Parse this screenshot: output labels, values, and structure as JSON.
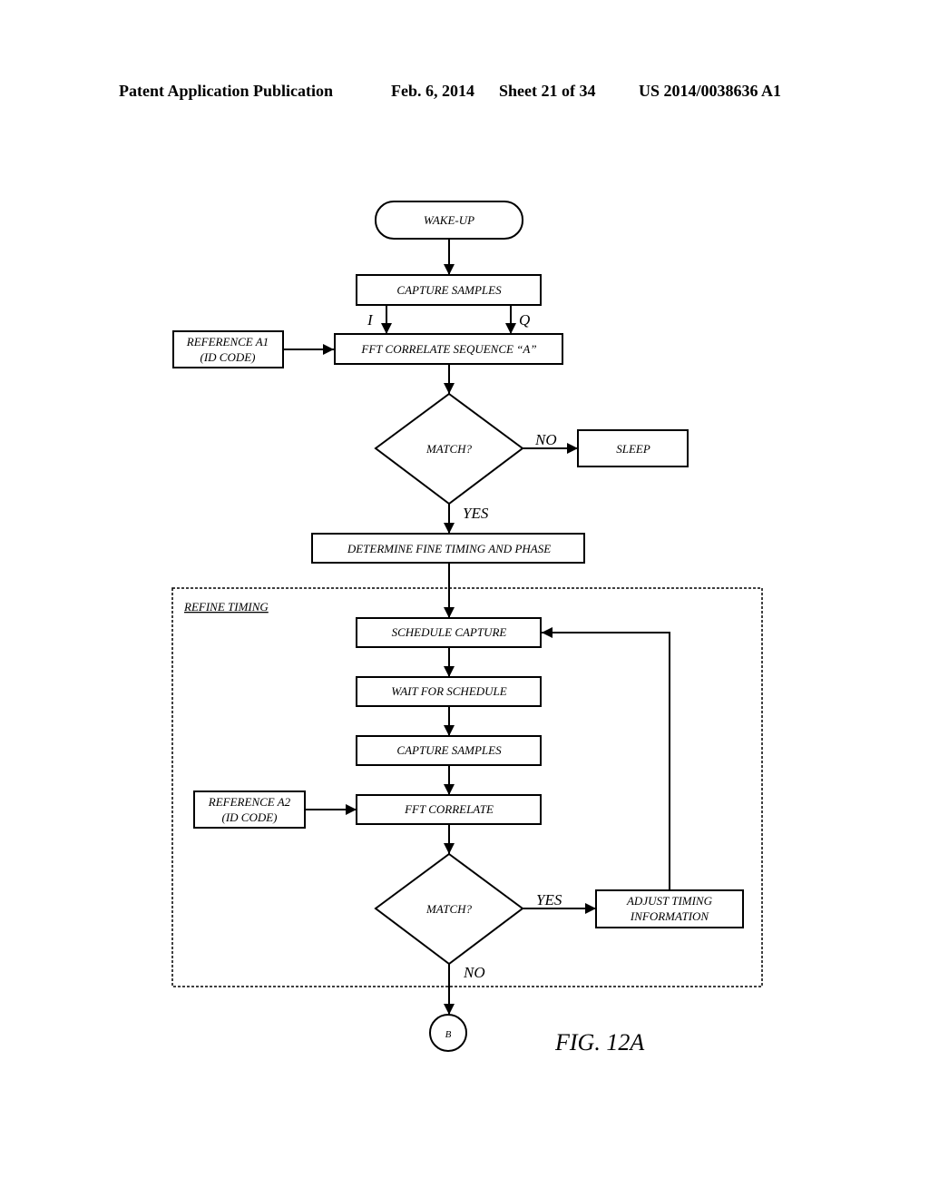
{
  "header": {
    "publication": "Patent Application Publication",
    "date": "Feb. 6, 2014",
    "sheet": "Sheet 21 of 34",
    "number": "US 2014/0038636 A1"
  },
  "diagram": {
    "nodes": {
      "wake_up": "WAKE-UP",
      "capture_samples_1": "CAPTURE SAMPLES",
      "reference_a1_line1": "REFERENCE A1",
      "reference_a1_line2": "(ID CODE)",
      "fft_correlate_seq_a": "FFT CORRELATE SEQUENCE “A”",
      "match_1": "MATCH?",
      "sleep": "SLEEP",
      "determine_fine_timing": "DETERMINE FINE TIMING AND PHASE",
      "schedule_capture": "SCHEDULE CAPTURE",
      "wait_for_schedule": "WAIT FOR SCHEDULE",
      "capture_samples_2": "CAPTURE SAMPLES",
      "reference_a2_line1": "REFERENCE A2",
      "reference_a2_line2": "(ID CODE)",
      "fft_correlate": "FFT CORRELATE",
      "match_2": "MATCH?",
      "adjust_timing_line1": "ADJUST TIMING",
      "adjust_timing_line2": "INFORMATION",
      "connector_b": "B"
    },
    "edge_labels": {
      "i": "I",
      "q": "Q",
      "no_1": "NO",
      "yes_1": "YES",
      "yes_2": "YES",
      "no_2": "NO"
    },
    "group_label": "REFINE TIMING",
    "figure_label": "FIG. 12A"
  }
}
